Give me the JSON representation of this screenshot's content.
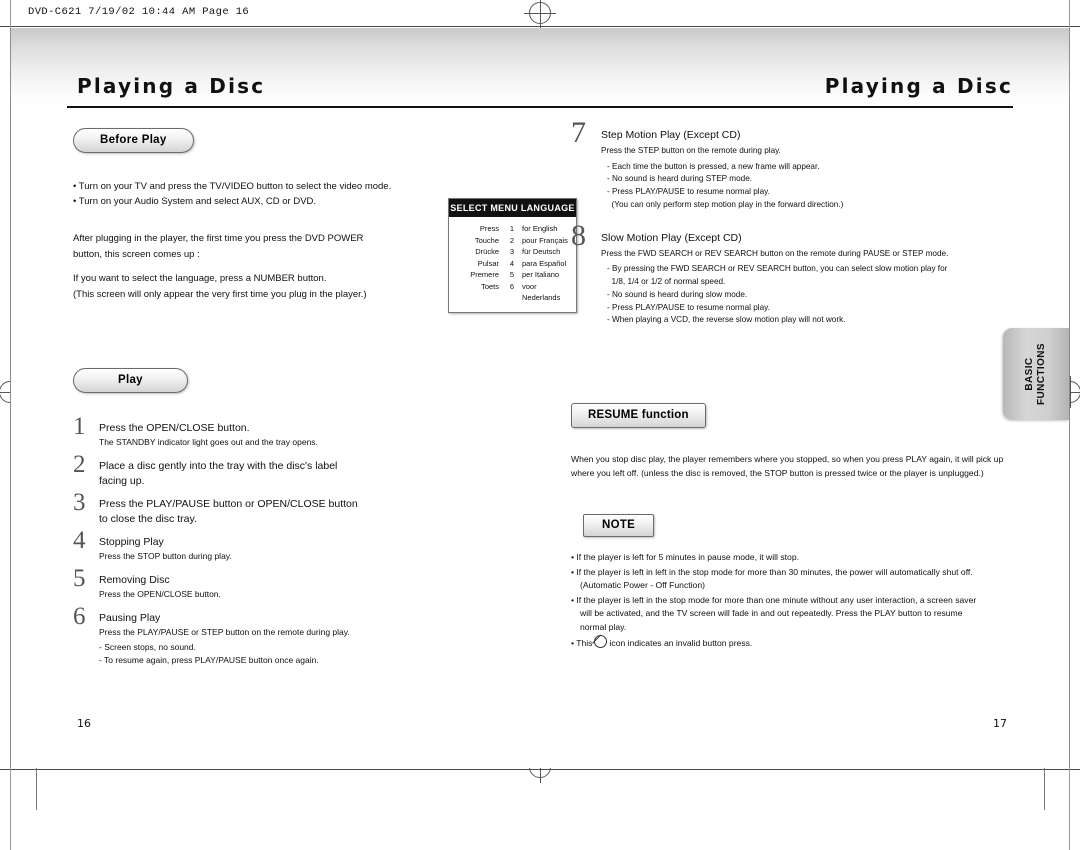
{
  "printer": {
    "slug": "DVD-C621  7/19/02 10:44 AM  Page 16"
  },
  "header": {
    "title_left": "Playing a Disc",
    "title_right": "Playing a Disc"
  },
  "side_tab": {
    "line1": "BASIC",
    "line2": "FUNCTIONS"
  },
  "folio": {
    "left": "16",
    "right": "17"
  },
  "left_column": {
    "before_play": {
      "pill": "Before Play",
      "bullets": [
        "• Turn on your TV and press the TV/VIDEO button to select the video mode.",
        "• Turn on your Audio System and select AUX, CD or DVD."
      ],
      "paragraph_lines": [
        "After plugging in the player, the first time you press the DVD POWER",
        "button, this screen comes up :",
        "If you want to select the language, press a NUMBER button.",
        "(This screen will only appear the very first time you plug in the player.)"
      ]
    },
    "language_box": {
      "title": "SELECT MENU LANGUAGE",
      "rows": [
        {
          "word": "Press",
          "num": "1",
          "lang": "for English"
        },
        {
          "word": "Touche",
          "num": "2",
          "lang": "pour Français"
        },
        {
          "word": "Drücke",
          "num": "3",
          "lang": "für Deutsch"
        },
        {
          "word": "Pulsar",
          "num": "4",
          "lang": "para Español"
        },
        {
          "word": "Premere",
          "num": "5",
          "lang": "per Italiano"
        },
        {
          "word": "Toets",
          "num": "6",
          "lang": "voor Nederlands"
        }
      ]
    },
    "play": {
      "pill": "Play",
      "steps": [
        {
          "num": "1",
          "title": "Press the OPEN/CLOSE button.",
          "detail": "The STANDBY indicator light goes out and the tray opens.",
          "sublines": []
        },
        {
          "num": "2",
          "title": "Place a disc gently into the tray with the disc's label",
          "title2": "facing up.",
          "detail": "",
          "sublines": []
        },
        {
          "num": "3",
          "title": "Press the PLAY/PAUSE button or OPEN/CLOSE button",
          "title2": "to close the disc tray.",
          "detail": "",
          "sublines": []
        },
        {
          "num": "4",
          "title": "Stopping Play",
          "detail": "Press the STOP button during play.",
          "sublines": []
        },
        {
          "num": "5",
          "title": "Removing Disc",
          "detail": "Press the OPEN/CLOSE button.",
          "sublines": []
        },
        {
          "num": "6",
          "title": "Pausing Play",
          "detail": "Press the PLAY/PAUSE or STEP button on the remote during play.",
          "sublines": [
            "- Screen stops, no sound.",
            "- To resume again, press PLAY/PAUSE button once again."
          ]
        }
      ]
    }
  },
  "right_column": {
    "steps": [
      {
        "num": "7",
        "title": "Step Motion Play (Except CD)",
        "detail": "Press the STEP button on the remote during play.",
        "sublines": [
          "- Each time the button is pressed, a new frame will appear.",
          "- No sound is heard during STEP mode.",
          "- Press PLAY/PAUSE to resume normal play.",
          "  (You can only perform step motion play in the forward direction.)"
        ]
      },
      {
        "num": "8",
        "title": "Slow Motion Play (Except CD)",
        "detail": "Press the FWD SEARCH or REV SEARCH button on the remote during PAUSE or STEP mode.",
        "sublines": [
          "- By pressing the FWD SEARCH or REV SEARCH button, you can select slow motion play for",
          "  1/8, 1/4 or 1/2 of normal speed.",
          "- No sound is heard during slow mode.",
          "- Press PLAY/PAUSE to resume normal play.",
          "- When playing a VCD, the reverse slow motion play will not work."
        ]
      }
    ],
    "resume": {
      "pill": "RESUME function",
      "lines": [
        "When you stop disc play, the player remembers where you stopped, so when you press PLAY again, it will pick up",
        "where you left off. (unless the disc is removed, the STOP button is pressed twice or the player is unplugged.)"
      ]
    },
    "note": {
      "pill": "NOTE",
      "items": [
        {
          "pre": "• If the player is left for 5 minutes in pause mode, it will stop.",
          "post": "",
          "symbol": false,
          "indent": []
        },
        {
          "pre": "• If the player is left in left in the stop mode for more than 30 minutes, the power will automatically shut off.",
          "post": "",
          "symbol": false,
          "indent": [
            "(Automatic Power - Off Function)"
          ]
        },
        {
          "pre": "• If the player is left in the stop mode for more than one minute without any user interaction, a screen saver",
          "post": "",
          "symbol": false,
          "indent": [
            "will be activated, and the TV screen will fade in and out repeatedly. Press the PLAY button to resume",
            "normal play."
          ]
        },
        {
          "pre": "• This",
          "post": "icon indicates an invalid button press.",
          "symbol": true,
          "indent": []
        }
      ]
    }
  }
}
